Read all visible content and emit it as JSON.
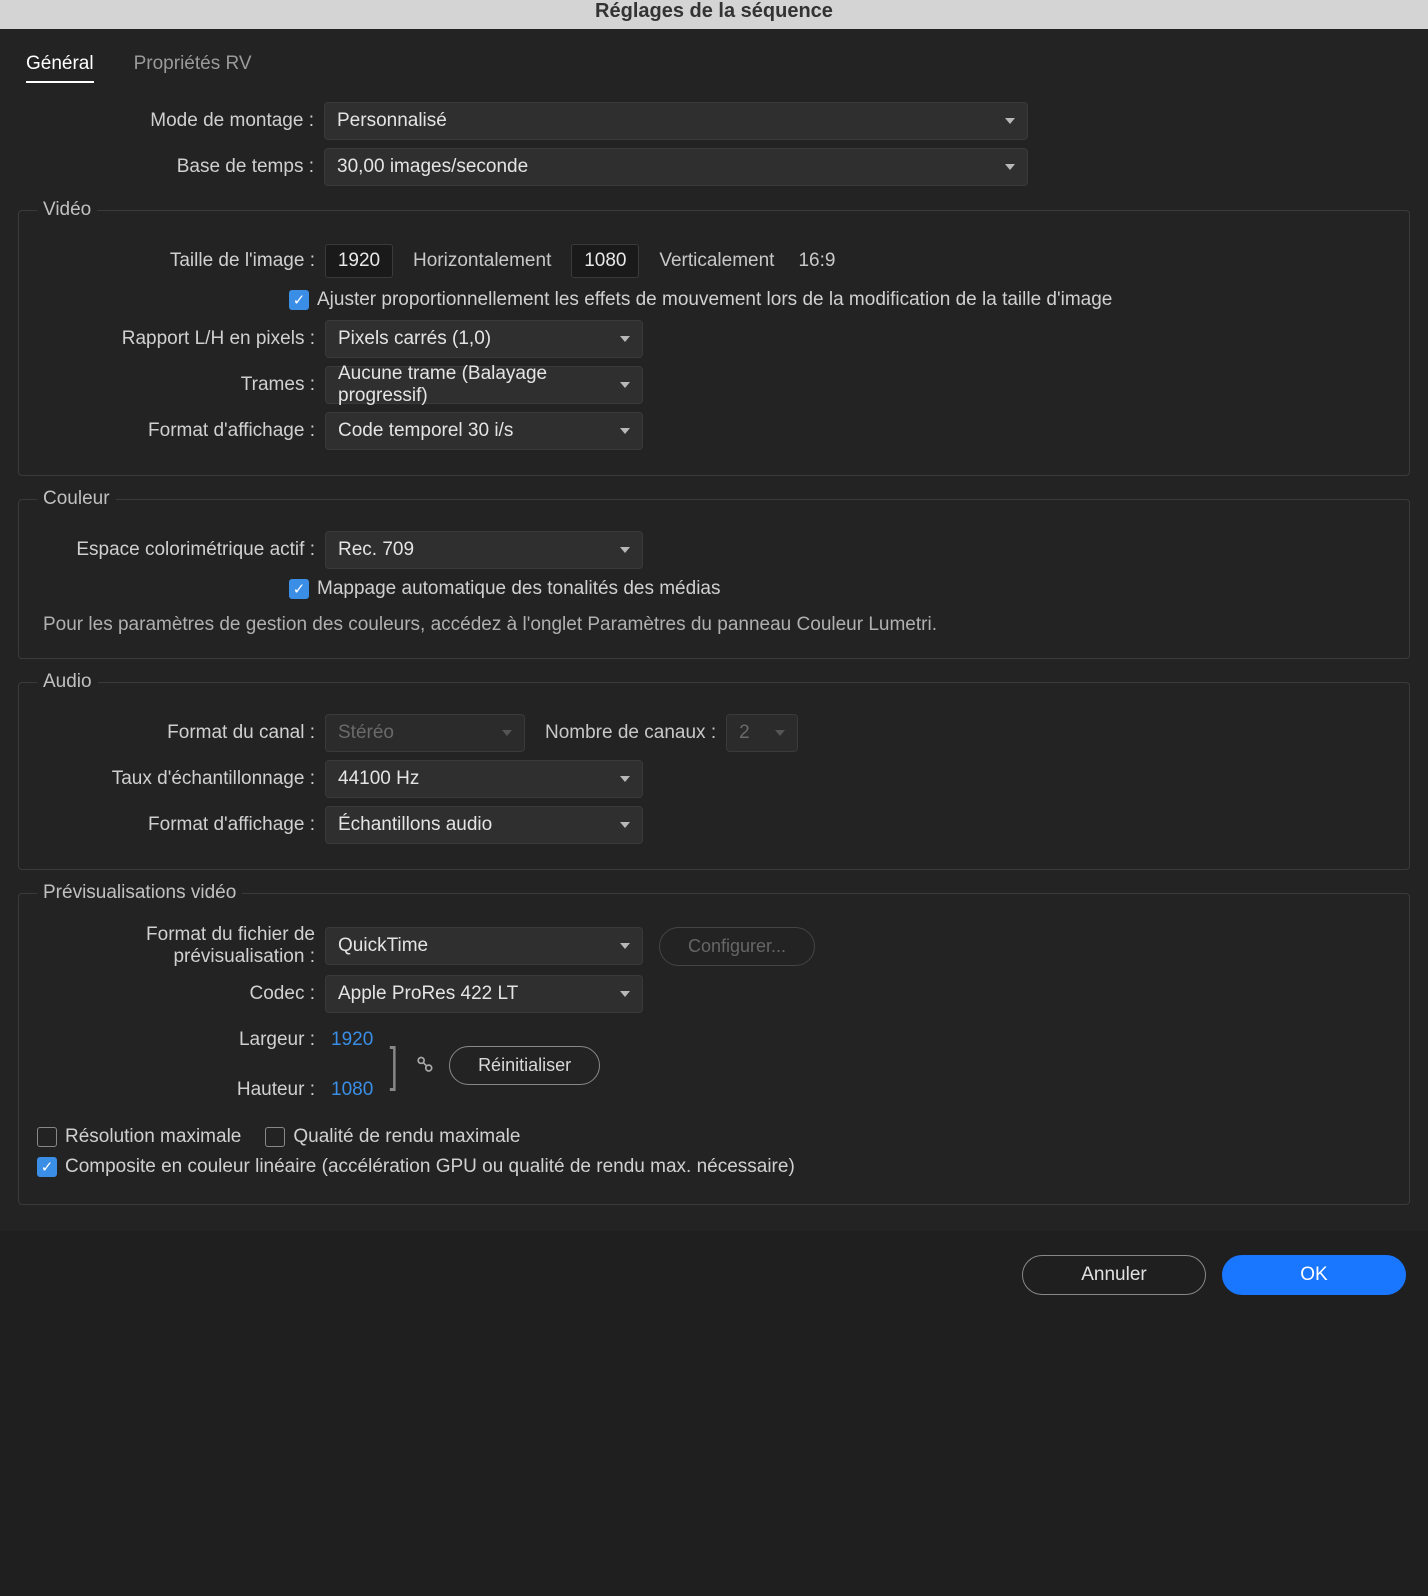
{
  "title": "Réglages de la séquence",
  "tabs": {
    "general": "Général",
    "vr": "Propriétés RV"
  },
  "top": {
    "editingModeLabel": "Mode de montage :",
    "editingModeValue": "Personnalisé",
    "timebaseLabel": "Base de temps :",
    "timebaseValue": "30,00  images/seconde"
  },
  "video": {
    "legend": "Vidéo",
    "frameSizeLabel": "Taille de l'image :",
    "width": "1920",
    "hLabel": "Horizontalement",
    "height": "1080",
    "vLabel": "Verticalement",
    "aspect": "16:9",
    "scaleEffects": "Ajuster proportionnellement les effets de mouvement lors de la modification de la taille d'image",
    "pixelLabel": "Rapport L/H en pixels :",
    "pixelValue": "Pixels carrés (1,0)",
    "fieldsLabel": "Trames :",
    "fieldsValue": "Aucune trame (Balayage progressif)",
    "dispLabel": "Format d'affichage :",
    "dispValue": "Code temporel 30 i/s"
  },
  "color": {
    "legend": "Couleur",
    "spaceLabel": "Espace colorimétrique actif :",
    "spaceValue": "Rec. 709",
    "autoMap": "Mappage automatique des tonalités des médias",
    "note": "Pour les paramètres de gestion des couleurs, accédez à l'onglet Paramètres du panneau Couleur Lumetri."
  },
  "audio": {
    "legend": "Audio",
    "chanFormatLabel": "Format du canal :",
    "chanFormatValue": "Stéréo",
    "numChanLabel": "Nombre de canaux :",
    "numChanValue": "2",
    "rateLabel": "Taux d'échantillonnage :",
    "rateValue": "44100 Hz",
    "dispLabel": "Format d'affichage :",
    "dispValue": "Échantillons audio"
  },
  "preview": {
    "legend": "Prévisualisations vidéo",
    "fileFormatLabel": "Format du fichier de prévisualisation :",
    "fileFormatValue": "QuickTime",
    "configure": "Configurer...",
    "codecLabel": "Codec :",
    "codecValue": "Apple ProRes 422 LT",
    "widthLabel": "Largeur :",
    "widthValue": "1920",
    "heightLabel": "Hauteur :",
    "heightValue": "1080",
    "reset": "Réinitialiser",
    "maxRes": "Résolution maximale",
    "maxQual": "Qualité de rendu maximale",
    "linear": "Composite en couleur linéaire (accélération GPU ou qualité de rendu max. nécessaire)"
  },
  "footer": {
    "cancel": "Annuler",
    "ok": "OK"
  }
}
